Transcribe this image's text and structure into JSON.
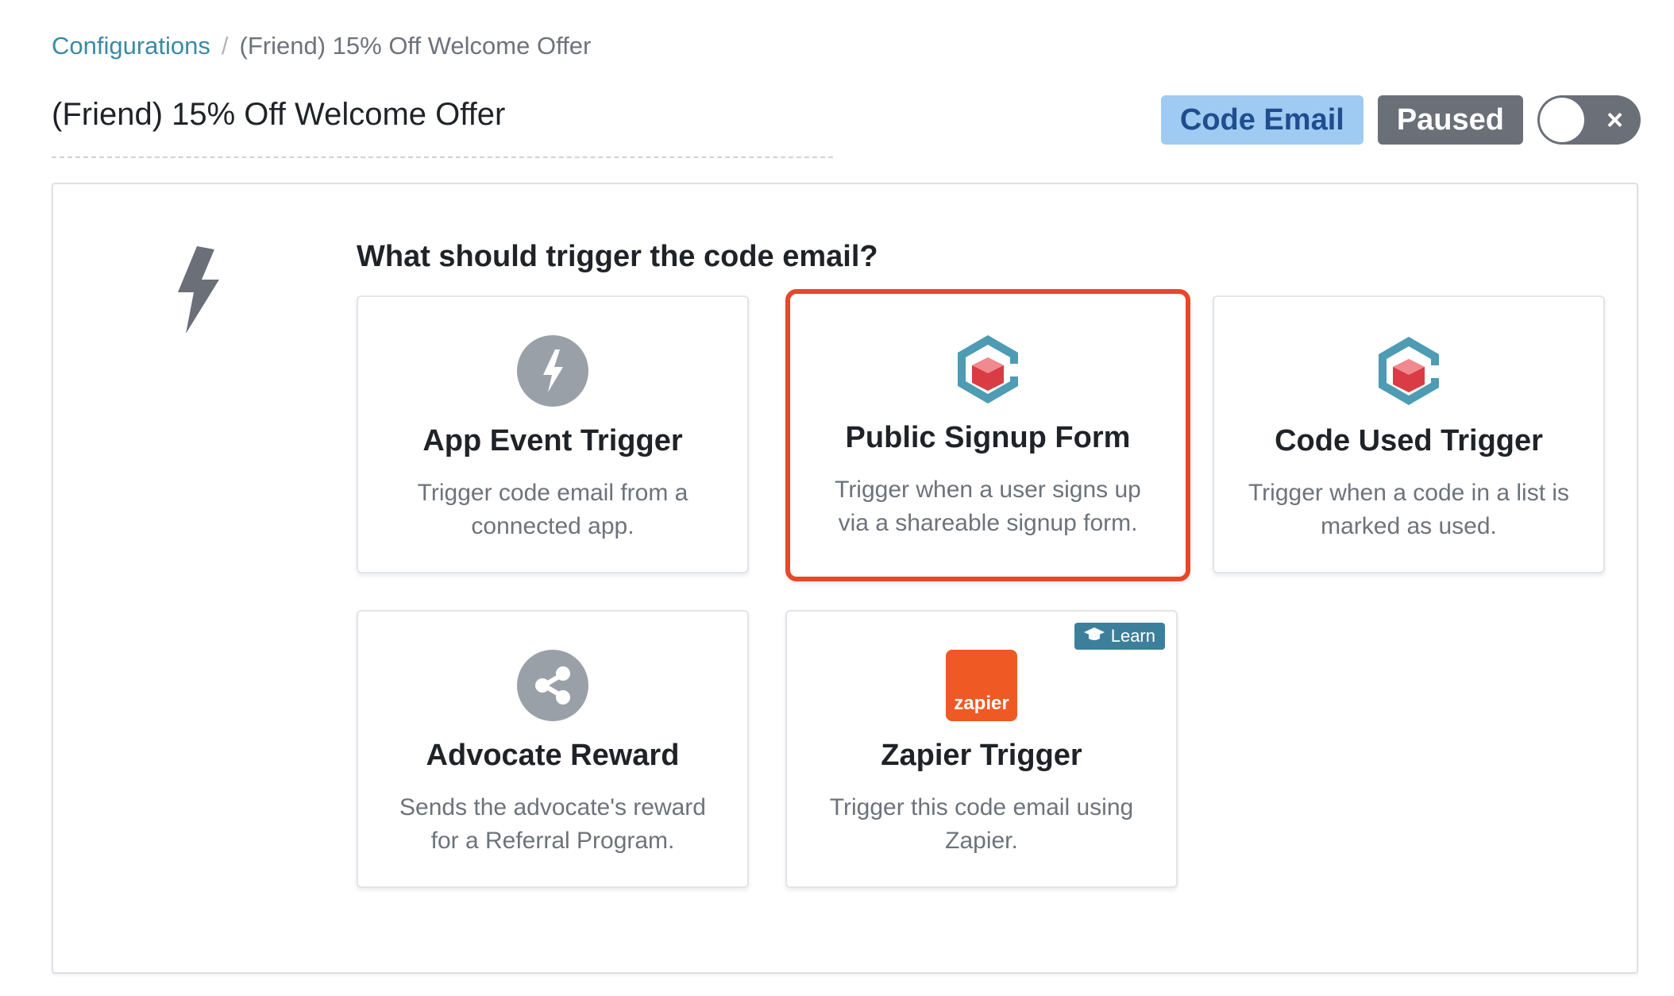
{
  "breadcrumb": {
    "link": "Configurations",
    "separator": "/",
    "current": "(Friend) 15% Off Welcome Offer"
  },
  "page_title": "(Friend) 15% Off Welcome Offer",
  "header": {
    "type_badge": "Code Email",
    "status_badge": "Paused",
    "toggle_state": "off",
    "toggle_icon": "×"
  },
  "section": {
    "icon": "bolt-icon",
    "question": "What should trigger the code email?"
  },
  "cards": [
    {
      "title": "App Event Trigger",
      "desc_line1": "Trigger code email from a",
      "desc_line2": "connected app.",
      "icon": "bolt-circle-icon",
      "selected": false
    },
    {
      "title": "Public Signup Form",
      "desc_line1": "Trigger when a user signs up",
      "desc_line2": "via a shareable signup form.",
      "icon": "cube-logo-icon",
      "selected": true
    },
    {
      "title": "Code Used Trigger",
      "desc_line1": "Trigger when a code in a list is",
      "desc_line2": "marked as used.",
      "icon": "cube-logo-icon",
      "selected": false
    },
    {
      "title": "Advocate Reward",
      "desc_line1": "Sends the advocate's reward",
      "desc_line2": "for a Referral Program.",
      "icon": "share-circle-icon",
      "selected": false
    },
    {
      "title": "Zapier Trigger",
      "desc_line1": "Trigger this code email using",
      "desc_line2": "Zapier.",
      "icon": "zapier-logo-icon",
      "logo_text": "zapier",
      "badge": "Learn",
      "selected": false
    }
  ],
  "colors": {
    "accent_link": "#3c8aa5",
    "selected_border": "#e8472a",
    "badge_type_bg": "#9fcaf2",
    "badge_status_bg": "#6a6f78",
    "zapier_orange": "#ef5a24"
  }
}
